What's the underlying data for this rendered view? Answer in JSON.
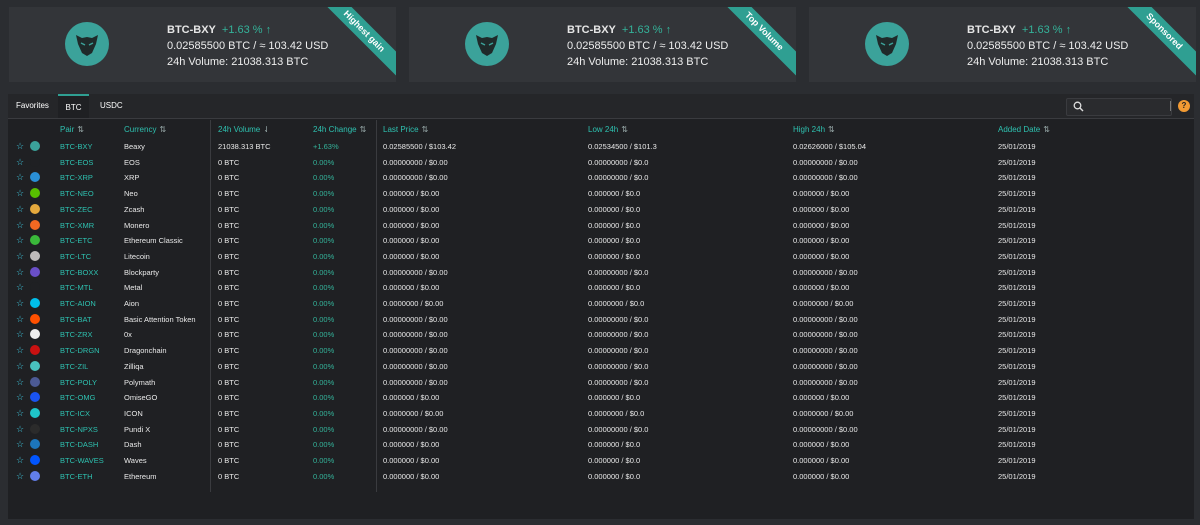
{
  "cards": [
    {
      "pair": "BTC-BXY",
      "change": "+1.63 % ↑",
      "price": "0.02585500 BTC / ≈ 103.42 USD",
      "volume": "24h Volume: 21038.313 BTC",
      "ribbon": "Highest gain"
    },
    {
      "pair": "BTC-BXY",
      "change": "+1.63 % ↑",
      "price": "0.02585500 BTC / ≈ 103.42 USD",
      "volume": "24h Volume: 21038.313 BTC",
      "ribbon": "Top Volume"
    },
    {
      "pair": "BTC-BXY",
      "change": "+1.63 % ↑",
      "price": "0.02585500 BTC / ≈ 103.42 USD",
      "volume": "24h Volume: 21038.313 BTC",
      "ribbon": "Sponsored"
    }
  ],
  "tabs": [
    "Favorites",
    "BTC",
    "USDC"
  ],
  "active_tab": "BTC",
  "help_label": "?",
  "columns": [
    "Pair",
    "Currency",
    "24h Volume",
    "24h Change",
    "Last Price",
    "Low 24h",
    "High 24h",
    "Added Date"
  ],
  "rows": [
    {
      "pair": "BTC-BXY",
      "currency": "Beaxy",
      "volume": "21038.313 BTC",
      "change": "+1.63%",
      "last": "0.02585500 / $103.42",
      "low": "0.02534500 / $101.3",
      "high": "0.02626000 / $105.04",
      "date": "25/01/2019",
      "color": "#3ba29a"
    },
    {
      "pair": "BTC-EOS",
      "currency": "EOS",
      "volume": "0 BTC",
      "change": "0.00%",
      "last": "0.00000000 / $0.00",
      "low": "0.00000000 / $0.0",
      "high": "0.00000000 / $0.00",
      "date": "25/01/2019",
      "color": "#1f2023"
    },
    {
      "pair": "BTC-XRP",
      "currency": "XRP",
      "volume": "0 BTC",
      "change": "0.00%",
      "last": "0.00000000 / $0.00",
      "low": "0.00000000 / $0.0",
      "high": "0.00000000 / $0.00",
      "date": "25/01/2019",
      "color": "#2a8fd6"
    },
    {
      "pair": "BTC-NEO",
      "currency": "Neo",
      "volume": "0 BTC",
      "change": "0.00%",
      "last": "0.000000 / $0.00",
      "low": "0.000000 / $0.0",
      "high": "0.000000 / $0.00",
      "date": "25/01/2019",
      "color": "#58bf00"
    },
    {
      "pair": "BTC-ZEC",
      "currency": "Zcash",
      "volume": "0 BTC",
      "change": "0.00%",
      "last": "0.000000 / $0.00",
      "low": "0.000000 / $0.0",
      "high": "0.000000 / $0.00",
      "date": "25/01/2019",
      "color": "#e5a93d"
    },
    {
      "pair": "BTC-XMR",
      "currency": "Monero",
      "volume": "0 BTC",
      "change": "0.00%",
      "last": "0.000000 / $0.00",
      "low": "0.000000 / $0.0",
      "high": "0.000000 / $0.00",
      "date": "25/01/2019",
      "color": "#f26822"
    },
    {
      "pair": "BTC-ETC",
      "currency": "Ethereum Classic",
      "volume": "0 BTC",
      "change": "0.00%",
      "last": "0.000000 / $0.00",
      "low": "0.000000 / $0.0",
      "high": "0.000000 / $0.00",
      "date": "25/01/2019",
      "color": "#3ab83a"
    },
    {
      "pair": "BTC-LTC",
      "currency": "Litecoin",
      "volume": "0 BTC",
      "change": "0.00%",
      "last": "0.000000 / $0.00",
      "low": "0.000000 / $0.0",
      "high": "0.000000 / $0.00",
      "date": "25/01/2019",
      "color": "#bfbbbb"
    },
    {
      "pair": "BTC-BOXX",
      "currency": "Blockparty",
      "volume": "0 BTC",
      "change": "0.00%",
      "last": "0.00000000 / $0.00",
      "low": "0.00000000 / $0.0",
      "high": "0.00000000 / $0.00",
      "date": "25/01/2019",
      "color": "#6a4fc8"
    },
    {
      "pair": "BTC-MTL",
      "currency": "Metal",
      "volume": "0 BTC",
      "change": "0.00%",
      "last": "0.000000 / $0.00",
      "low": "0.000000 / $0.0",
      "high": "0.000000 / $0.00",
      "date": "25/01/2019",
      "color": "#1f2023"
    },
    {
      "pair": "BTC-AION",
      "currency": "Aion",
      "volume": "0 BTC",
      "change": "0.00%",
      "last": "0.0000000 / $0.00",
      "low": "0.0000000 / $0.0",
      "high": "0.0000000 / $0.00",
      "date": "25/01/2019",
      "color": "#00bfec"
    },
    {
      "pair": "BTC-BAT",
      "currency": "Basic Attention Token",
      "volume": "0 BTC",
      "change": "0.00%",
      "last": "0.00000000 / $0.00",
      "low": "0.00000000 / $0.0",
      "high": "0.00000000 / $0.00",
      "date": "25/01/2019",
      "color": "#ff5000"
    },
    {
      "pair": "BTC-ZRX",
      "currency": "0x",
      "volume": "0 BTC",
      "change": "0.00%",
      "last": "0.00000000 / $0.00",
      "low": "0.00000000 / $0.0",
      "high": "0.00000000 / $0.00",
      "date": "25/01/2019",
      "color": "#eeeeee"
    },
    {
      "pair": "BTC-DRGN",
      "currency": "Dragonchain",
      "volume": "0 BTC",
      "change": "0.00%",
      "last": "0.00000000 / $0.00",
      "low": "0.00000000 / $0.0",
      "high": "0.00000000 / $0.00",
      "date": "25/01/2019",
      "color": "#c91111"
    },
    {
      "pair": "BTC-ZIL",
      "currency": "Zilliqa",
      "volume": "0 BTC",
      "change": "0.00%",
      "last": "0.00000000 / $0.00",
      "low": "0.00000000 / $0.0",
      "high": "0.00000000 / $0.00",
      "date": "25/01/2019",
      "color": "#49c1bf"
    },
    {
      "pair": "BTC-POLY",
      "currency": "Polymath",
      "volume": "0 BTC",
      "change": "0.00%",
      "last": "0.00000000 / $0.00",
      "low": "0.00000000 / $0.0",
      "high": "0.00000000 / $0.00",
      "date": "25/01/2019",
      "color": "#4c5a95"
    },
    {
      "pair": "BTC-OMG",
      "currency": "OmiseGO",
      "volume": "0 BTC",
      "change": "0.00%",
      "last": "0.000000 / $0.00",
      "low": "0.000000 / $0.0",
      "high": "0.000000 / $0.00",
      "date": "25/01/2019",
      "color": "#1a53f0"
    },
    {
      "pair": "BTC-ICX",
      "currency": "ICON",
      "volume": "0 BTC",
      "change": "0.00%",
      "last": "0.0000000 / $0.00",
      "low": "0.0000000 / $0.0",
      "high": "0.0000000 / $0.00",
      "date": "25/01/2019",
      "color": "#1fc5c9"
    },
    {
      "pair": "BTC-NPXS",
      "currency": "Pundi X",
      "volume": "0 BTC",
      "change": "0.00%",
      "last": "0.00000000 / $0.00",
      "low": "0.00000000 / $0.0",
      "high": "0.00000000 / $0.00",
      "date": "25/01/2019",
      "color": "#2b2b2b"
    },
    {
      "pair": "BTC-DASH",
      "currency": "Dash",
      "volume": "0 BTC",
      "change": "0.00%",
      "last": "0.000000 / $0.00",
      "low": "0.000000 / $0.0",
      "high": "0.000000 / $0.00",
      "date": "25/01/2019",
      "color": "#1c75bc"
    },
    {
      "pair": "BTC-WAVES",
      "currency": "Waves",
      "volume": "0 BTC",
      "change": "0.00%",
      "last": "0.000000 / $0.00",
      "low": "0.000000 / $0.0",
      "high": "0.000000 / $0.00",
      "date": "25/01/2019",
      "color": "#0155ff"
    },
    {
      "pair": "BTC-ETH",
      "currency": "Ethereum",
      "volume": "0 BTC",
      "change": "0.00%",
      "last": "0.000000 / $0.00",
      "low": "0.000000 / $0.0",
      "high": "0.000000 / $0.00",
      "date": "25/01/2019",
      "color": "#627eea"
    }
  ]
}
